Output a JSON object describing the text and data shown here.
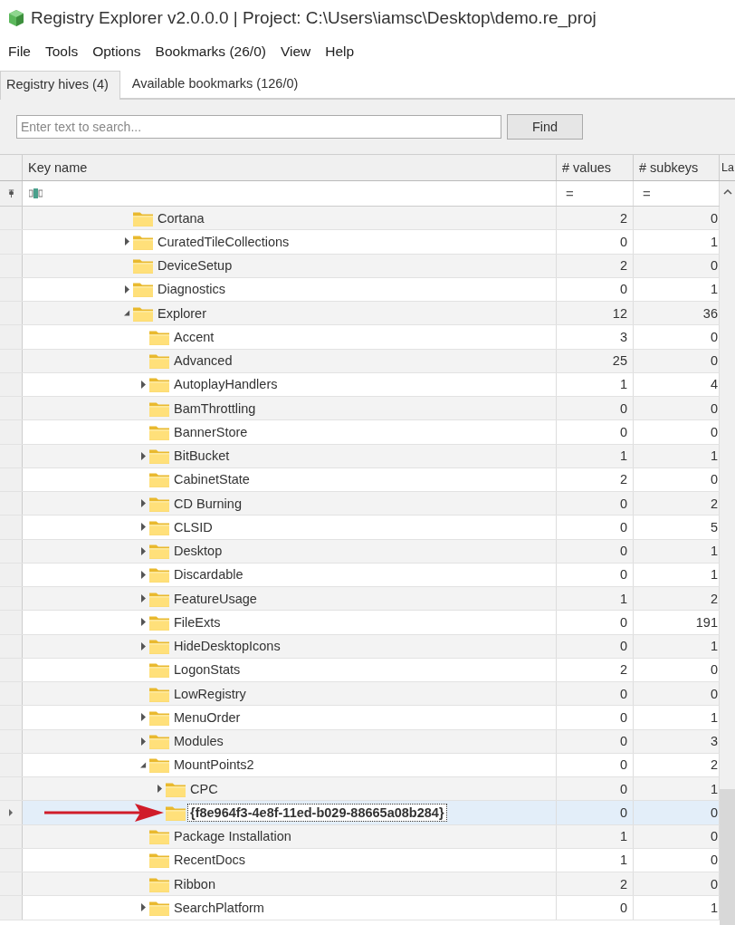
{
  "window": {
    "title": "Registry Explorer v2.0.0.0 | Project: C:\\Users\\iamsc\\Desktop\\demo.re_proj"
  },
  "menu": [
    "File",
    "Tools",
    "Options",
    "Bookmarks (26/0)",
    "View",
    "Help"
  ],
  "tabs": [
    {
      "label": "Registry hives (4)",
      "selected": true
    },
    {
      "label": "Available bookmarks (126/0)",
      "selected": false
    }
  ],
  "search": {
    "placeholder": "Enter text to search...",
    "button": "Find"
  },
  "table": {
    "columns": [
      "Key name",
      "# values",
      "# subkeys",
      "La"
    ],
    "filters": [
      "=",
      "="
    ],
    "rows": [
      {
        "name": "Cortana",
        "values": "2",
        "subkeys": "0",
        "has_children": false,
        "selected": false
      },
      {
        "name": "CuratedTileCollections",
        "values": "0",
        "subkeys": "1",
        "has_children": true,
        "expanded": false,
        "selected": false
      },
      {
        "name": "DeviceSetup",
        "values": "2",
        "subkeys": "0",
        "has_children": false,
        "selected": false
      },
      {
        "name": "Diagnostics",
        "values": "0",
        "subkeys": "1",
        "has_children": true,
        "expanded": false,
        "selected": false
      },
      {
        "name": "Explorer",
        "values": "12",
        "subkeys": "36",
        "has_children": true,
        "expanded": true,
        "selected": false,
        "children": [
          {
            "name": "Accent",
            "values": "3",
            "subkeys": "0",
            "has_children": false,
            "selected": false
          },
          {
            "name": "Advanced",
            "values": "25",
            "subkeys": "0",
            "has_children": false,
            "selected": false
          },
          {
            "name": "AutoplayHandlers",
            "values": "1",
            "subkeys": "4",
            "has_children": true,
            "expanded": false,
            "selected": false
          },
          {
            "name": "BamThrottling",
            "values": "0",
            "subkeys": "0",
            "has_children": false,
            "selected": false
          },
          {
            "name": "BannerStore",
            "values": "0",
            "subkeys": "0",
            "has_children": false,
            "selected": false
          },
          {
            "name": "BitBucket",
            "values": "1",
            "subkeys": "1",
            "has_children": true,
            "expanded": false,
            "selected": false
          },
          {
            "name": "CabinetState",
            "values": "2",
            "subkeys": "0",
            "has_children": false,
            "selected": false
          },
          {
            "name": "CD Burning",
            "values": "0",
            "subkeys": "2",
            "has_children": true,
            "expanded": false,
            "selected": false
          },
          {
            "name": "CLSID",
            "values": "0",
            "subkeys": "5",
            "has_children": true,
            "expanded": false,
            "selected": false
          },
          {
            "name": "Desktop",
            "values": "0",
            "subkeys": "1",
            "has_children": true,
            "expanded": false,
            "selected": false
          },
          {
            "name": "Discardable",
            "values": "0",
            "subkeys": "1",
            "has_children": true,
            "expanded": false,
            "selected": false
          },
          {
            "name": "FeatureUsage",
            "values": "1",
            "subkeys": "2",
            "has_children": true,
            "expanded": false,
            "selected": false
          },
          {
            "name": "FileExts",
            "values": "0",
            "subkeys": "191",
            "has_children": true,
            "expanded": false,
            "selected": false
          },
          {
            "name": "HideDesktopIcons",
            "values": "0",
            "subkeys": "1",
            "has_children": true,
            "expanded": false,
            "selected": false
          },
          {
            "name": "LogonStats",
            "values": "2",
            "subkeys": "0",
            "has_children": false,
            "selected": false
          },
          {
            "name": "LowRegistry",
            "values": "0",
            "subkeys": "0",
            "has_children": false,
            "selected": false
          },
          {
            "name": "MenuOrder",
            "values": "0",
            "subkeys": "1",
            "has_children": true,
            "expanded": false,
            "selected": false
          },
          {
            "name": "Modules",
            "values": "0",
            "subkeys": "3",
            "has_children": true,
            "expanded": false,
            "selected": false
          },
          {
            "name": "MountPoints2",
            "values": "0",
            "subkeys": "2",
            "has_children": true,
            "expanded": true,
            "selected": false,
            "children": [
              {
                "name": "CPC",
                "values": "0",
                "subkeys": "1",
                "has_children": true,
                "expanded": false,
                "selected": false
              },
              {
                "name": "{f8e964f3-4e8f-11ed-b029-88665a08b284}",
                "values": "0",
                "subkeys": "0",
                "has_children": false,
                "selected": true,
                "pointer_arrow": true
              }
            ]
          },
          {
            "name": "Package Installation",
            "values": "1",
            "subkeys": "0",
            "has_children": false,
            "selected": false
          },
          {
            "name": "RecentDocs",
            "values": "1",
            "subkeys": "0",
            "has_children": false,
            "selected": false
          },
          {
            "name": "Ribbon",
            "values": "2",
            "subkeys": "0",
            "has_children": false,
            "selected": false
          },
          {
            "name": "SearchPlatform",
            "values": "0",
            "subkeys": "1",
            "has_children": true,
            "expanded": false,
            "selected": false
          }
        ]
      }
    ]
  }
}
